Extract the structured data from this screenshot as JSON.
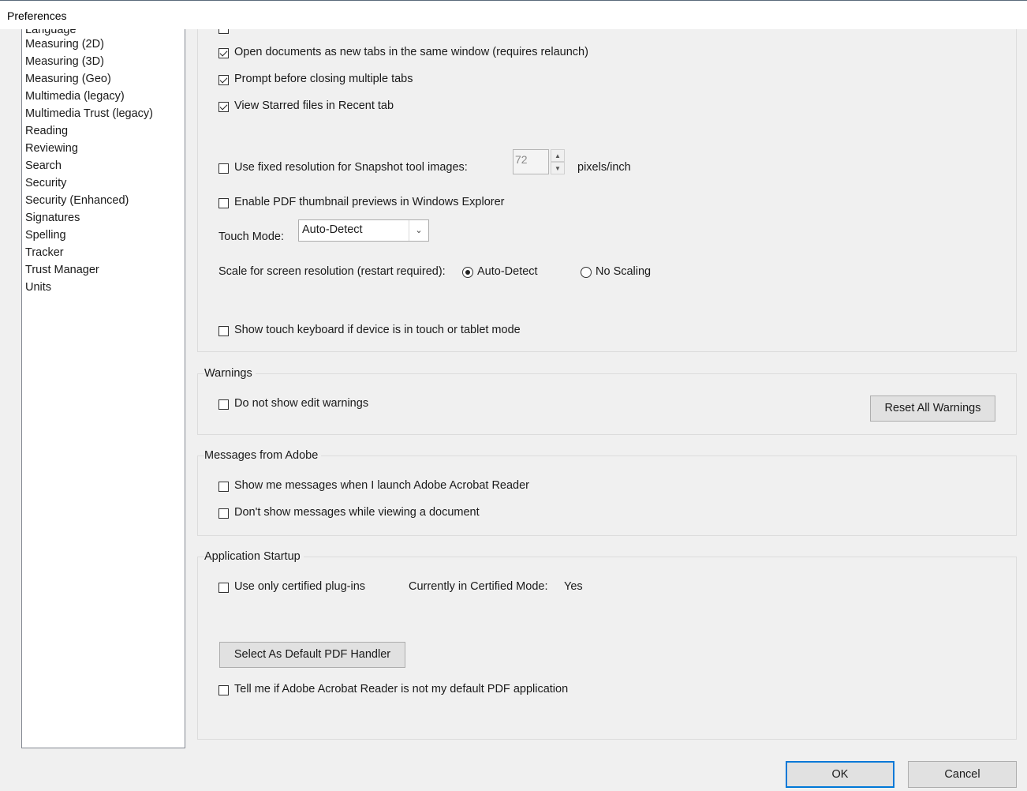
{
  "window": {
    "title": "Preferences"
  },
  "sidebar": {
    "items": [
      {
        "label": "Language"
      },
      {
        "label": "Measuring (2D)"
      },
      {
        "label": "Measuring (3D)"
      },
      {
        "label": "Measuring (Geo)"
      },
      {
        "label": "Multimedia (legacy)"
      },
      {
        "label": "Multimedia Trust (legacy)"
      },
      {
        "label": "Reading"
      },
      {
        "label": "Reviewing"
      },
      {
        "label": "Search"
      },
      {
        "label": "Security"
      },
      {
        "label": "Security (Enhanced)"
      },
      {
        "label": "Signatures"
      },
      {
        "label": "Spelling"
      },
      {
        "label": "Tracker"
      },
      {
        "label": "Trust Manager"
      },
      {
        "label": "Units"
      }
    ]
  },
  "general": {
    "open_tabs": {
      "label": "Open documents as new tabs in the same window (requires relaunch)",
      "checked": true
    },
    "prompt_close_tabs": {
      "label": "Prompt before closing multiple tabs",
      "checked": true
    },
    "view_starred": {
      "label": "View Starred files in Recent tab",
      "checked": true
    },
    "snapshot": {
      "label": "Use fixed resolution for Snapshot tool images:",
      "checked": false,
      "value": "72",
      "unit": "pixels/inch"
    },
    "thumbnail": {
      "label": "Enable PDF thumbnail previews in Windows Explorer",
      "checked": false
    },
    "touch_mode": {
      "label": "Touch Mode:",
      "value": "Auto-Detect"
    },
    "scale": {
      "label": "Scale for screen resolution (restart required):",
      "options": [
        "Auto-Detect",
        "No Scaling"
      ],
      "selected": "Auto-Detect"
    },
    "touch_keyboard": {
      "label": "Show touch keyboard if device is in touch or tablet mode",
      "checked": false
    }
  },
  "warnings": {
    "title": "Warnings",
    "no_edit_warnings": {
      "label": "Do not show edit warnings",
      "checked": false
    },
    "reset_button": "Reset All Warnings"
  },
  "messages": {
    "title": "Messages from Adobe",
    "launch_messages": {
      "label": "Show me messages when I launch Adobe Acrobat Reader",
      "checked": false
    },
    "viewing_messages": {
      "label": "Don't show messages while viewing a document",
      "checked": false
    }
  },
  "startup": {
    "title": "Application Startup",
    "certified_plugins": {
      "label": "Use only certified plug-ins",
      "checked": false
    },
    "certified_mode_label": "Currently in Certified Mode:",
    "certified_mode_value": "Yes",
    "default_handler_button": "Select As Default PDF Handler",
    "tell_default": {
      "label": "Tell me if Adobe Acrobat Reader is not my default PDF application",
      "checked": false
    }
  },
  "footer": {
    "ok": "OK",
    "cancel": "Cancel"
  }
}
